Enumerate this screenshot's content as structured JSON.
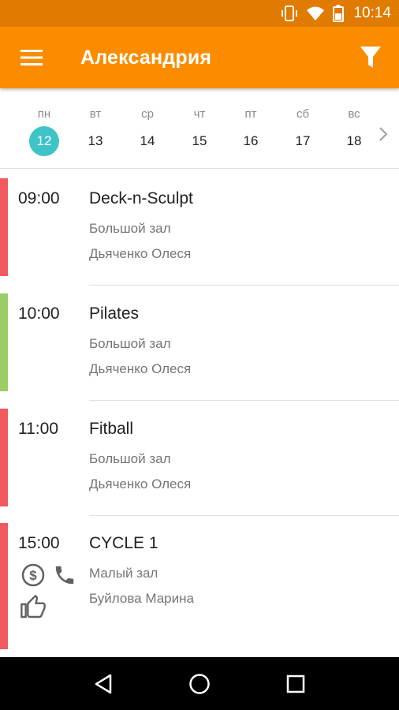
{
  "status_bar": {
    "time": "10:14",
    "icons": [
      "vibrate-icon",
      "wifi-icon",
      "battery-icon"
    ]
  },
  "app_bar": {
    "title": "Александрия",
    "background": "#fb8c00",
    "icons": [
      "menu-icon",
      "filter-icon"
    ]
  },
  "week": {
    "days": [
      {
        "dow": "пн",
        "date": "12",
        "selected": true
      },
      {
        "dow": "вт",
        "date": "13",
        "selected": false
      },
      {
        "dow": "ср",
        "date": "14",
        "selected": false
      },
      {
        "dow": "чт",
        "date": "15",
        "selected": false
      },
      {
        "dow": "пт",
        "date": "16",
        "selected": false
      },
      {
        "dow": "сб",
        "date": "17",
        "selected": false
      },
      {
        "dow": "вс",
        "date": "18",
        "selected": false
      }
    ],
    "selected_color": "#3ec3c7",
    "next_icon": "chevron-right-icon"
  },
  "schedule": [
    {
      "time": "09:00",
      "name": "Deck-n-Sculpt",
      "room": "Большой зал",
      "trainer": "Дьяченко Олеся",
      "color": "#f0595e"
    },
    {
      "time": "10:00",
      "name": "Pilates",
      "room": "Большой зал",
      "trainer": "Дьяченко Олеся",
      "color": "#9ccc65"
    },
    {
      "time": "11:00",
      "name": "Fitball",
      "room": "Большой зал",
      "trainer": "Дьяченко Олеся",
      "color": "#f0595e"
    },
    {
      "time": "15:00",
      "name": "CYCLE 1",
      "room": "Малый зал",
      "trainer": "Буйлова Марина",
      "color": "#f0595e",
      "action_icons": [
        "paid-icon",
        "phone-icon",
        "like-icon"
      ]
    }
  ],
  "nav_bar": {
    "icons": [
      "back-icon",
      "home-icon",
      "recents-icon"
    ]
  }
}
